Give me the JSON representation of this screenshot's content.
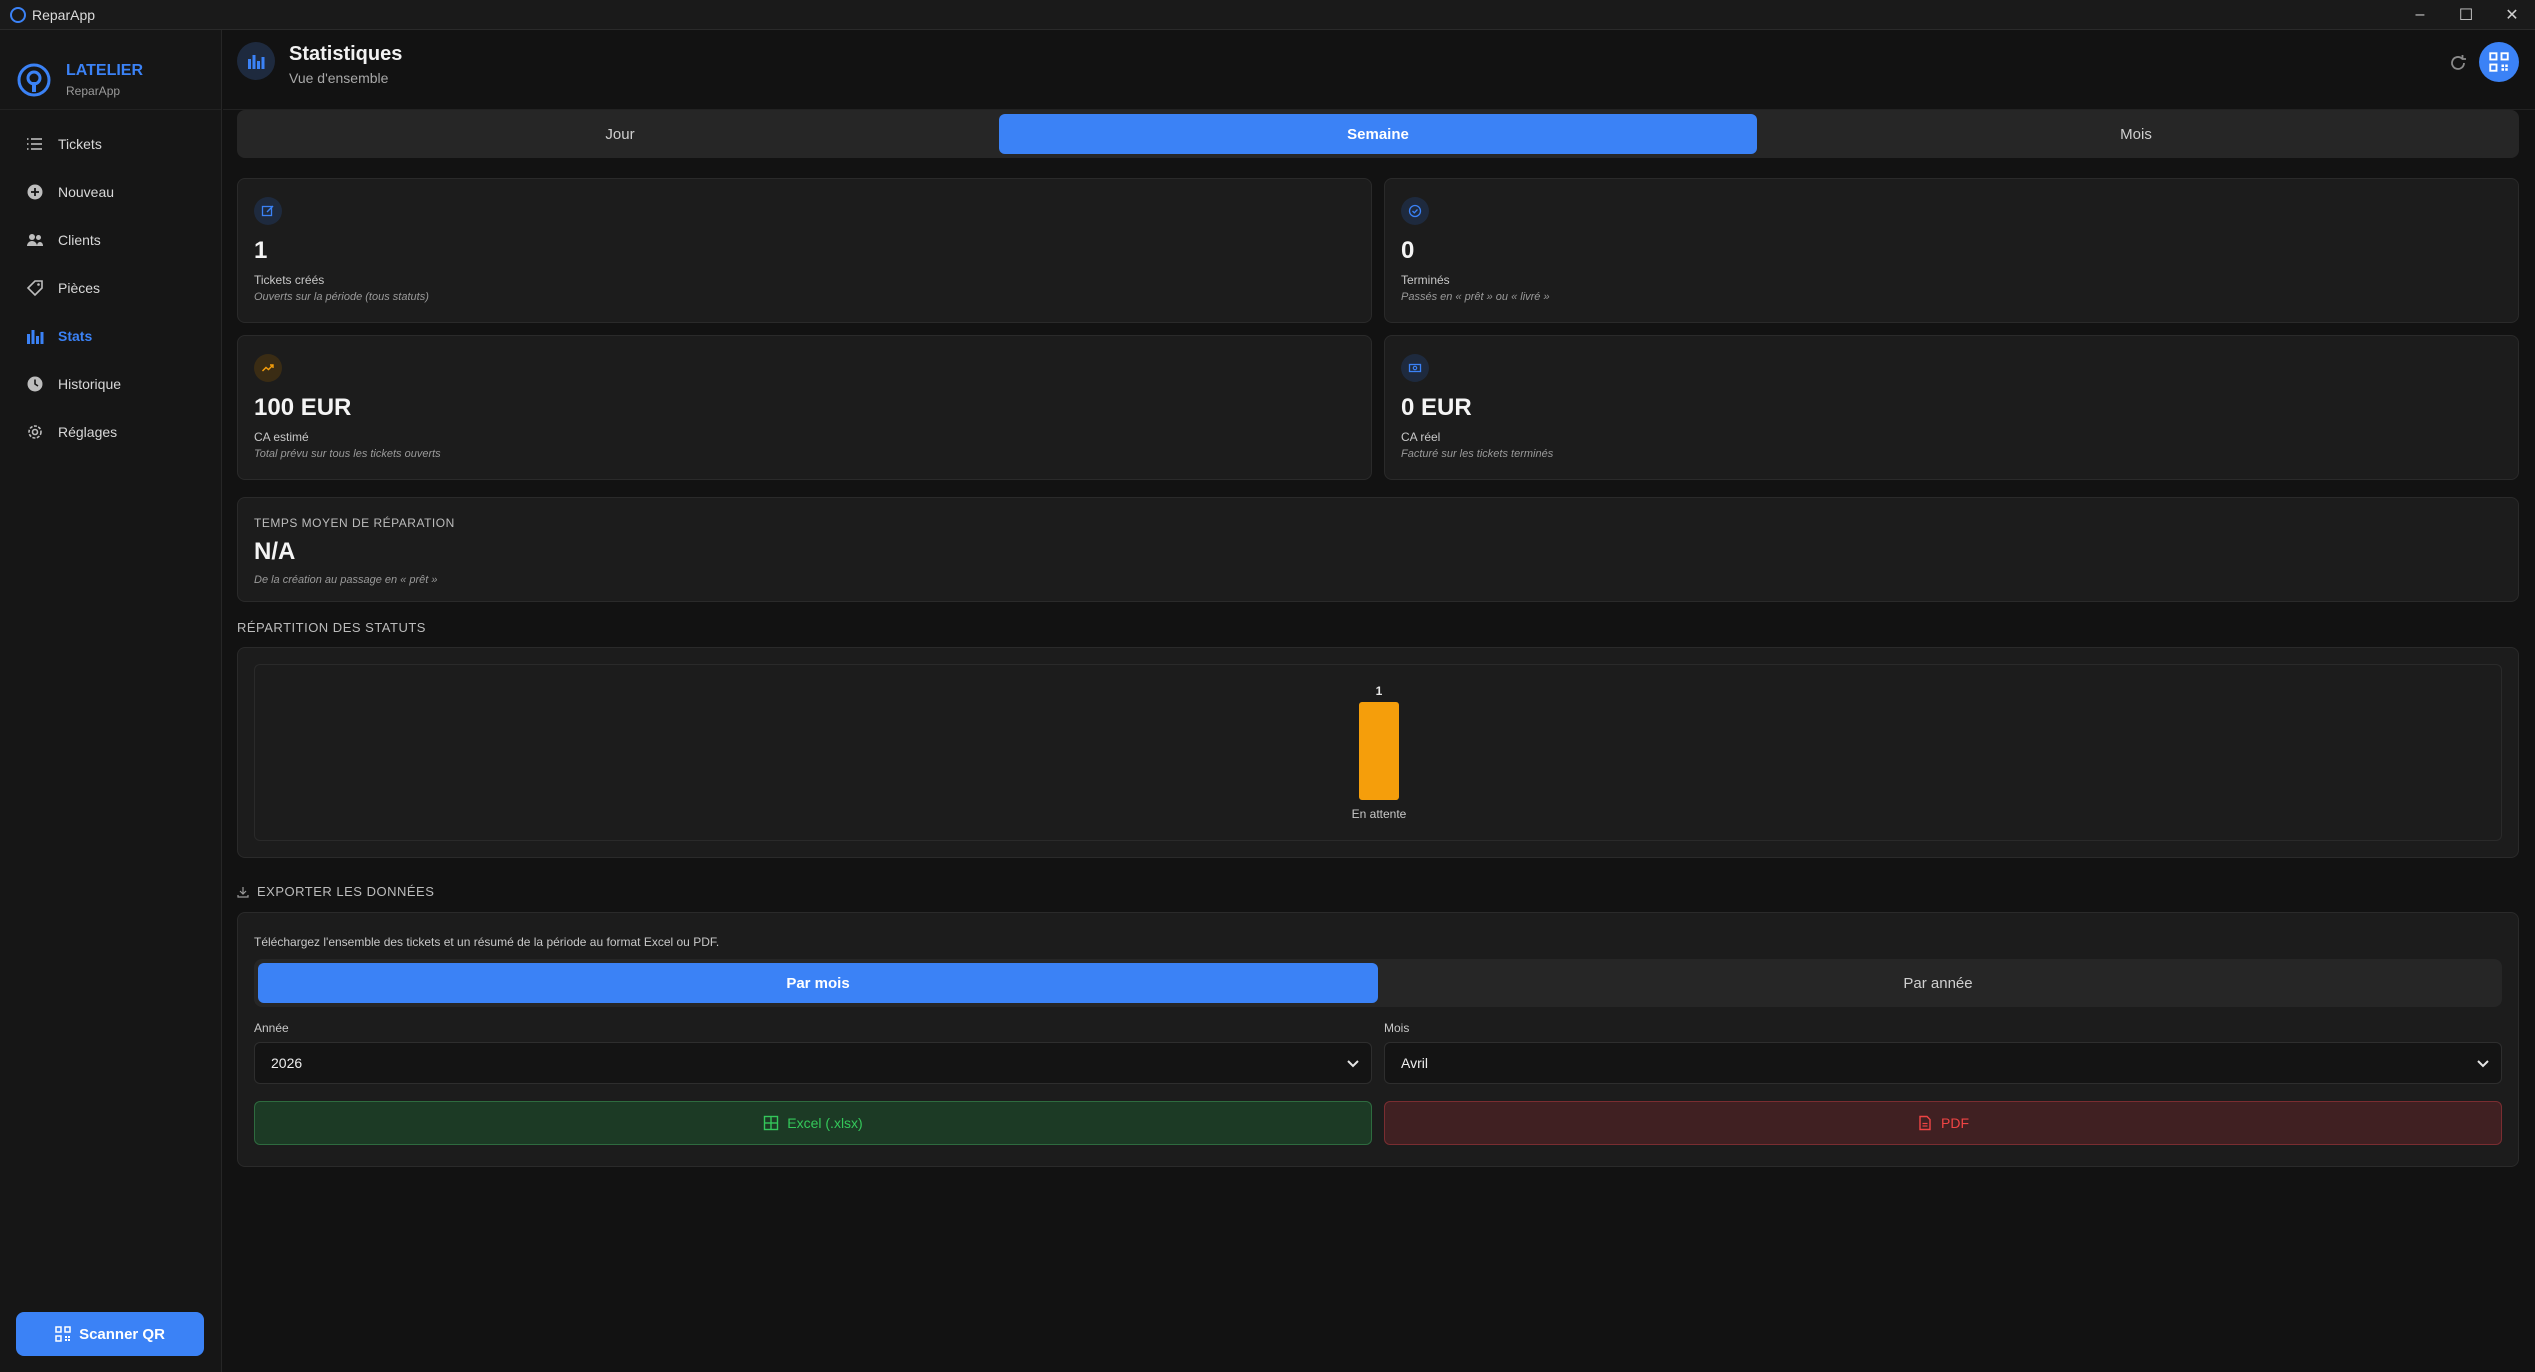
{
  "window": {
    "title": "ReparApp",
    "controls": [
      "–",
      "☐",
      "✕"
    ]
  },
  "brand": {
    "name": "LATELIER",
    "sub": "ReparApp"
  },
  "nav": [
    {
      "label": "Tickets",
      "icon": "list-icon",
      "active": false
    },
    {
      "label": "Nouveau",
      "icon": "plus-circle-icon",
      "active": false
    },
    {
      "label": "Clients",
      "icon": "users-icon",
      "active": false
    },
    {
      "label": "Pièces",
      "icon": "tag-icon",
      "active": false
    },
    {
      "label": "Stats",
      "icon": "bar-chart-icon",
      "active": true
    },
    {
      "label": "Historique",
      "icon": "clock-icon",
      "active": false
    },
    {
      "label": "Réglages",
      "icon": "gear-icon",
      "active": false
    }
  ],
  "scan_button": "Scanner QR",
  "header": {
    "title": "Statistiques",
    "subtitle": "Vue d'ensemble"
  },
  "period_tabs": {
    "options": [
      "Jour",
      "Semaine",
      "Mois"
    ],
    "selected": "Semaine"
  },
  "kpis": [
    {
      "value": "1",
      "label": "Tickets créés",
      "desc": "Ouverts sur la période (tous statuts)",
      "icon": "edit-icon",
      "color": "#3b82f6"
    },
    {
      "value": "0",
      "label": "Terminés",
      "desc": "Passés en « prêt » ou « livré »",
      "icon": "check-circle-icon",
      "color": "#3b82f6"
    },
    {
      "value": "100 EUR",
      "label": "CA estimé",
      "desc": "Total prévu sur tous les tickets ouverts",
      "icon": "trending-up-icon",
      "color": "#f59e0b"
    },
    {
      "value": "0 EUR",
      "label": "CA réel",
      "desc": "Facturé sur les tickets terminés",
      "icon": "cash-icon",
      "color": "#3b82f6"
    }
  ],
  "avg_repair": {
    "label": "TEMPS MOYEN DE RÉPARATION",
    "value": "N/A",
    "desc": "De la création au passage en « prêt »"
  },
  "status_section": {
    "title": "RÉPARTITION DES STATUTS"
  },
  "chart_data": {
    "type": "bar",
    "categories": [
      "En attente"
    ],
    "values": [
      1
    ],
    "colors": [
      "#f59e0b"
    ],
    "ylim": [
      0,
      1
    ]
  },
  "export": {
    "title": "EXPORTER LES DONNÉES",
    "description": "Téléchargez l'ensemble des tickets et un résumé de la période au format Excel ou PDF.",
    "modes": [
      "Par mois",
      "Par année"
    ],
    "selected_mode": "Par mois",
    "year_label": "Année",
    "year_value": "2026",
    "month_label": "Mois",
    "month_value": "Avril",
    "excel_label": "Excel (.xlsx)",
    "pdf_label": "PDF"
  },
  "colors": {
    "accent": "#3b82f6",
    "excel": "#34c75a",
    "pdf": "#ef4444",
    "pending": "#f59e0b"
  }
}
